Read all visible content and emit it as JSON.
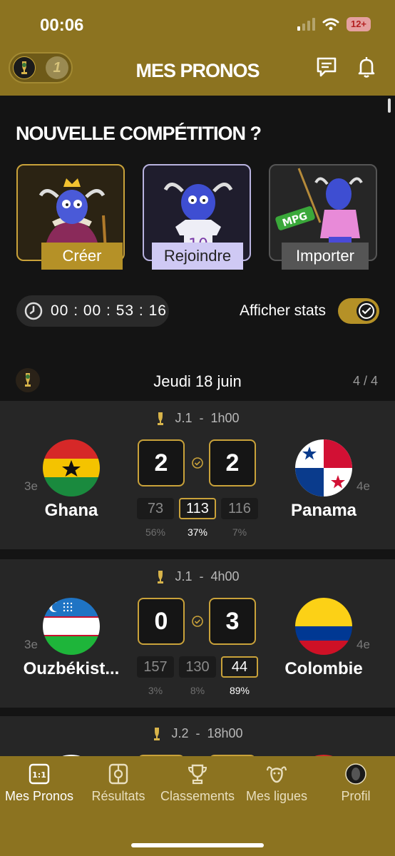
{
  "status": {
    "time": "00:06",
    "battery": "12+"
  },
  "header": {
    "title": "MES PRONOS",
    "switcher_alt": "1"
  },
  "section": {
    "title": "NOUVELLE COMPÉTITION ?"
  },
  "cards": {
    "create": "Créer",
    "join": "Rejoindre",
    "import": "Importer",
    "join_jersey": "10",
    "import_badge": "MPG"
  },
  "timer": "00 : 00 : 53 : 16",
  "stats_toggle": {
    "label": "Afficher stats",
    "on": true
  },
  "day": {
    "label": "Jeudi 18 juin",
    "count": "4 / 4"
  },
  "matches": [
    {
      "round": "J.1",
      "sep": "-",
      "time": "1h00",
      "home": {
        "name": "Ghana",
        "rank": "3e"
      },
      "away": {
        "name": "Panama",
        "rank": "4e"
      },
      "score": [
        "2",
        "2"
      ],
      "stats": [
        "73",
        "113",
        "116"
      ],
      "pcts": [
        "56%",
        "37%",
        "7%"
      ],
      "selected": 1
    },
    {
      "round": "J.1",
      "sep": "-",
      "time": "4h00",
      "home": {
        "name": "Ouzbékist...",
        "rank": "3e"
      },
      "away": {
        "name": "Colombie",
        "rank": "4e"
      },
      "score": [
        "0",
        "3"
      ],
      "stats": [
        "157",
        "130",
        "44"
      ],
      "pcts": [
        "3%",
        "8%",
        "89%"
      ],
      "selected": 2
    },
    {
      "round": "J.2",
      "sep": "-",
      "time": "18h00"
    }
  ],
  "tabs": [
    {
      "label": "Mes Pronos",
      "icon": "1:1"
    },
    {
      "label": "Résultats"
    },
    {
      "label": "Classements"
    },
    {
      "label": "Mes ligues"
    },
    {
      "label": "Profil"
    }
  ],
  "colors": {
    "gold": "#8c7320",
    "accent": "#c9a23a",
    "bg": "#141414",
    "card": "#262626"
  }
}
